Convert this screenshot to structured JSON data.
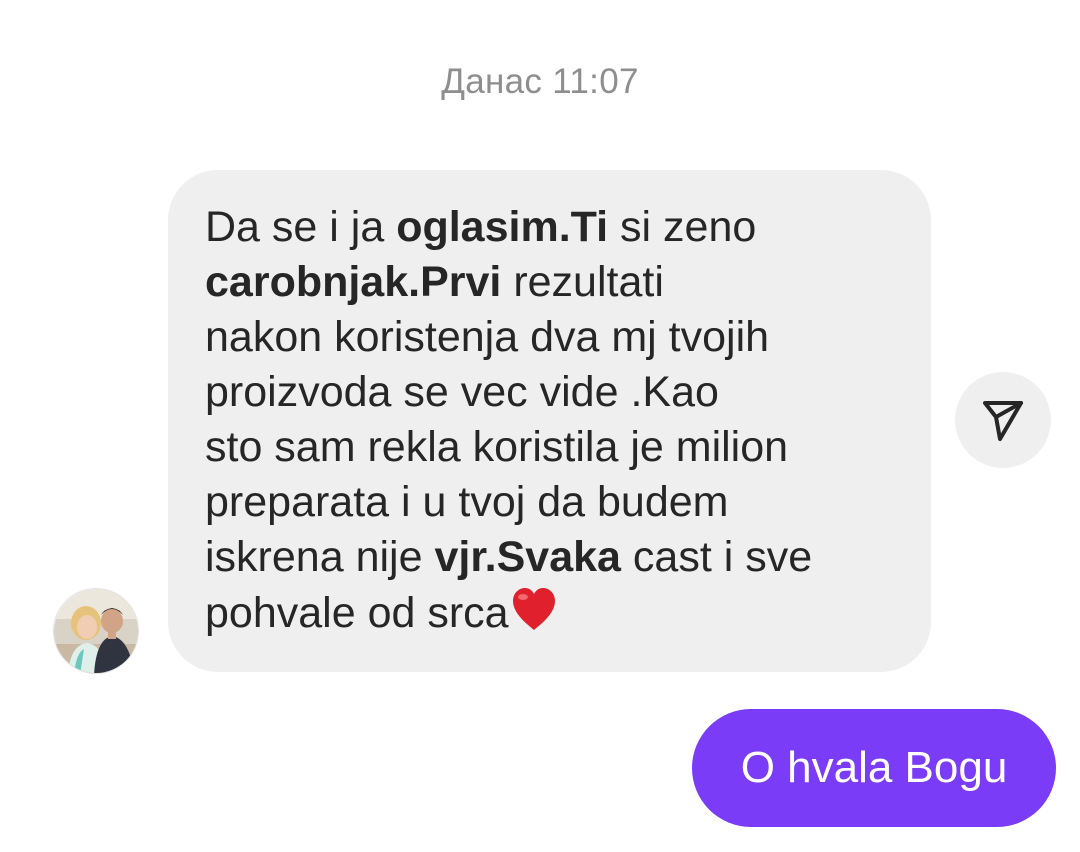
{
  "timestamp": "Данас 11:07",
  "incoming_message": {
    "lines": [
      [
        {
          "text": "Da se i ja ",
          "bold": false
        },
        {
          "text": "oglasim.Ti",
          "bold": true
        },
        {
          "text": " si zeno",
          "bold": false
        }
      ],
      [
        {
          "text": "carobnjak.Prvi",
          "bold": true
        },
        {
          "text": " rezultati",
          "bold": false
        }
      ],
      [
        {
          "text": "nakon koristenja dva mj tvojih",
          "bold": false
        }
      ],
      [
        {
          "text": "proizvoda se vec vide .Kao",
          "bold": false
        }
      ],
      [
        {
          "text": "sto sam rekla koristila je milion",
          "bold": false
        }
      ],
      [
        {
          "text": "preparata i u tvoj da budem",
          "bold": false
        }
      ],
      [
        {
          "text": "iskrena nije ",
          "bold": false
        },
        {
          "text": "vjr.Svaka",
          "bold": true
        },
        {
          "text": " cast i sve",
          "bold": false
        }
      ],
      [
        {
          "text": "pohvale od srca",
          "bold": false
        }
      ]
    ],
    "emoji_icon": "red-heart-icon",
    "bubble_color": "#efefef",
    "text_color": "#262626"
  },
  "sender_avatar_icon": "profile-photo-icon",
  "share_button_icon": "paper-plane-icon",
  "outgoing_message": {
    "text": "O hvala Bogu",
    "bubble_color": "#7a3cf6",
    "text_color": "#ffffff"
  }
}
